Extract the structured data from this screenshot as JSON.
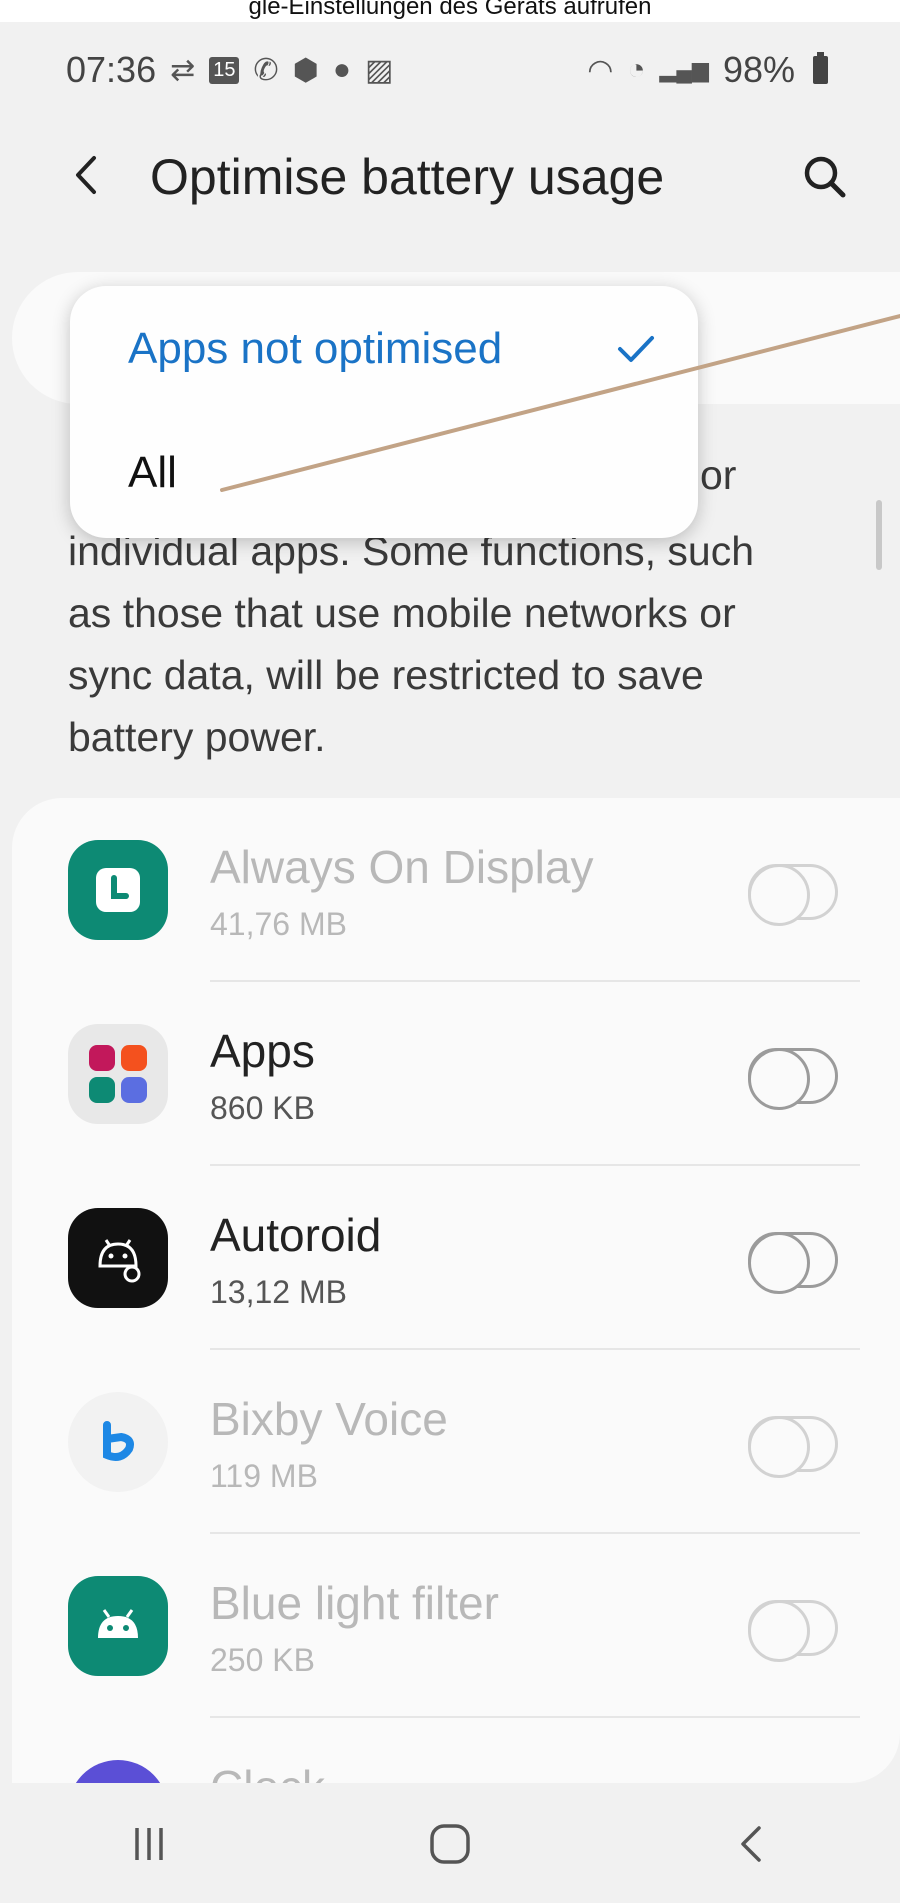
{
  "caption": "gle-Einstellungen des Geräts aufrufen",
  "status_bar": {
    "time": "07:36",
    "calendar_day": "15",
    "battery": "98%"
  },
  "header": {
    "title": "Optimise battery usage"
  },
  "filter_menu": {
    "options": [
      {
        "label": "Apps not optimised",
        "selected": true
      },
      {
        "label": "All",
        "selected": false
      }
    ]
  },
  "description": {
    "visible_tail": "or",
    "lines": [
      "individual apps. Some functions, such",
      "as those that use mobile networks or",
      "sync data, will be restricted to save",
      "battery power."
    ]
  },
  "apps": [
    {
      "name": "Always On Display",
      "size": "41,76 MB",
      "enabled": false,
      "icon": "clock-icon",
      "color": "#0d8a74"
    },
    {
      "name": "Apps",
      "size": "860 KB",
      "enabled": true,
      "icon": "apps-folder-icon",
      "color": "#e8e8e8"
    },
    {
      "name": "Autoroid",
      "size": "13,12 MB",
      "enabled": true,
      "icon": "android-gear-icon",
      "color": "#111111"
    },
    {
      "name": "Bixby Voice",
      "size": "119 MB",
      "enabled": false,
      "icon": "bixby-icon",
      "color": "#1e88e5"
    },
    {
      "name": "Blue light filter",
      "size": "250 KB",
      "enabled": false,
      "icon": "android-icon",
      "color": "#0d8a74"
    },
    {
      "name": "Clock",
      "size": "",
      "enabled": false,
      "icon": "clock-app-icon",
      "color": "#5b4fd6"
    }
  ],
  "colors": {
    "accent": "#1a73c6",
    "pointer": "#c2a386"
  }
}
